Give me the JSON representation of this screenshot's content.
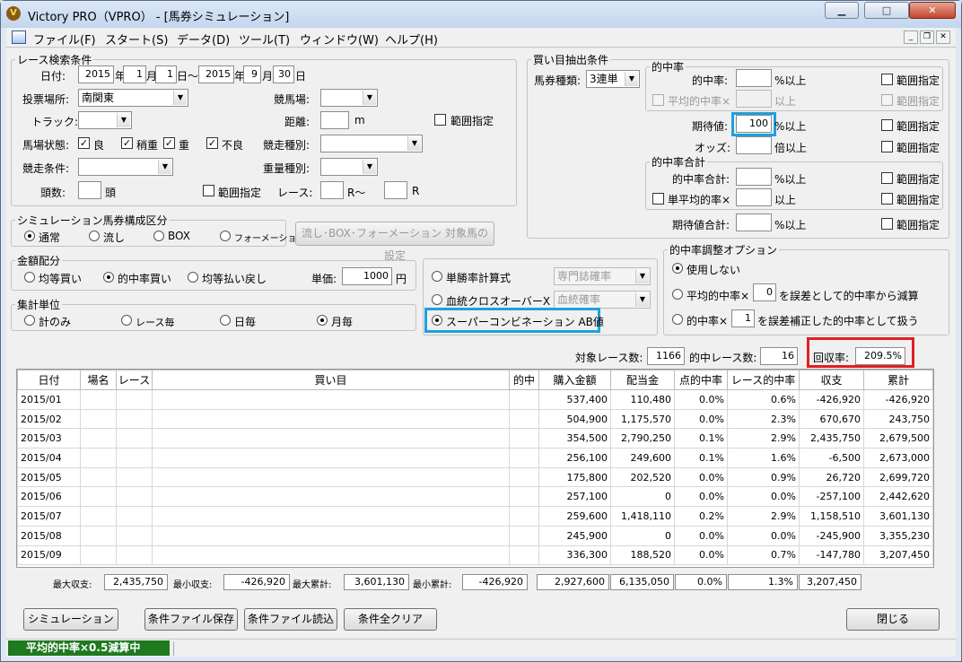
{
  "title": "Victory PRO（VPRO） - [馬券シミュレーション]",
  "menu": [
    "ファイル(F)",
    "スタート(S)",
    "データ(D)",
    "ツール(T)",
    "ウィンドウ(W)",
    "ヘルプ(H)"
  ],
  "race_search": {
    "legend": "レース検索条件",
    "date_label": "日付:",
    "y1": "2015",
    "y_unit": "年",
    "m1": "1",
    "m_unit": "月",
    "d1": "1",
    "d_unit_range": "日～",
    "y2": "2015",
    "m2": "9",
    "d2": "30",
    "d_unit": "日",
    "venue_label": "投票場所:",
    "venue": "南関東",
    "track_label": "競馬場:",
    "track": "",
    "course_label": "トラック:",
    "course": "",
    "distance_label": "距離:",
    "distance": "",
    "distance_unit": "m",
    "range_label": "範囲指定",
    "condition_label": "馬場状態:",
    "cond": [
      "良",
      "稍重",
      "重",
      "不良"
    ],
    "race_type_label": "競走種別:",
    "race_cond_label": "競走条件:",
    "weight_label": "重量種別:",
    "heads_label": "頭数:",
    "heads_unit": "頭",
    "race_label": "レース:",
    "race_r1": "R～",
    "race_r2": "R"
  },
  "sim_type": {
    "legend": "シミュレーション馬券構成区分",
    "options": [
      "通常",
      "流し",
      "BOX",
      "フォーメーション"
    ],
    "set_button": "流し･BOX･フォーメーション 対象馬の設定"
  },
  "money": {
    "legend": "金額配分",
    "options": [
      "均等買い",
      "的中率買い",
      "均等払い戻し"
    ],
    "unit_label": "単価:",
    "unit_value": "1000",
    "yen": "円"
  },
  "agg": {
    "legend": "集計単位",
    "options": [
      "計のみ",
      "レース毎",
      "日毎",
      "月毎"
    ]
  },
  "calc": {
    "options": [
      "単勝率計算式",
      "血統クロスオーバーX",
      "スーパーコンビネーション AB値"
    ],
    "combo1": "専門誌確率",
    "combo2": "血統確率"
  },
  "extract": {
    "legend": "買い目抽出条件",
    "bet_type_label": "馬券種類:",
    "bet_type": "3連単",
    "hit_legend": "的中率",
    "hit_rate": "的中率:",
    "pct_over": "%以上",
    "avg_hit": "平均的中率×",
    "over": "以上",
    "expect": "期待値:",
    "expect_value": "100",
    "odds": "オッズ:",
    "times_over": "倍以上",
    "range": "範囲指定",
    "total_legend": "的中率合計",
    "hit_total": "的中率合計:",
    "single_avg": "単平均的率×",
    "expect_total": "期待値合計:"
  },
  "adjust": {
    "legend": "的中率調整オプション",
    "opt1": "使用しない",
    "opt2a": "平均的中率×",
    "opt2v": "0",
    "opt2b": "を誤差として的中率から減算",
    "opt3a": "的中率×",
    "opt3v": "1",
    "opt3b": "を誤差補正した的中率として扱う"
  },
  "counts": {
    "target_label": "対象レース数:",
    "target": "1166",
    "hit_label": "的中レース数:",
    "hit": "16",
    "recovery_label": "回収率:",
    "recovery": "209.5%"
  },
  "table": {
    "headers": [
      "日付",
      "場名",
      "レース",
      "買い目",
      "的中",
      "購入金額",
      "配当金",
      "点的中率",
      "レース的中率",
      "収支",
      "累計"
    ],
    "rows": [
      [
        "2015/01",
        "",
        "",
        "",
        "",
        "537,400",
        "110,480",
        "0.0%",
        "0.6%",
        "-426,920",
        "-426,920"
      ],
      [
        "2015/02",
        "",
        "",
        "",
        "",
        "504,900",
        "1,175,570",
        "0.0%",
        "2.3%",
        "670,670",
        "243,750"
      ],
      [
        "2015/03",
        "",
        "",
        "",
        "",
        "354,500",
        "2,790,250",
        "0.1%",
        "2.9%",
        "2,435,750",
        "2,679,500"
      ],
      [
        "2015/04",
        "",
        "",
        "",
        "",
        "256,100",
        "249,600",
        "0.1%",
        "1.6%",
        "-6,500",
        "2,673,000"
      ],
      [
        "2015/05",
        "",
        "",
        "",
        "",
        "175,800",
        "202,520",
        "0.0%",
        "0.9%",
        "26,720",
        "2,699,720"
      ],
      [
        "2015/06",
        "",
        "",
        "",
        "",
        "257,100",
        "0",
        "0.0%",
        "0.0%",
        "-257,100",
        "2,442,620"
      ],
      [
        "2015/07",
        "",
        "",
        "",
        "",
        "259,600",
        "1,418,110",
        "0.2%",
        "2.9%",
        "1,158,510",
        "3,601,130"
      ],
      [
        "2015/08",
        "",
        "",
        "",
        "",
        "245,900",
        "0",
        "0.0%",
        "0.0%",
        "-245,900",
        "3,355,230"
      ],
      [
        "2015/09",
        "",
        "",
        "",
        "",
        "336,300",
        "188,520",
        "0.0%",
        "0.7%",
        "-147,780",
        "3,207,450"
      ]
    ]
  },
  "summary": {
    "max_income_label": "最大収支:",
    "max_income": "2,435,750",
    "min_income_label": "最小収支:",
    "min_income": "-426,920",
    "max_total_label": "最大累計:",
    "max_total": "3,601,130",
    "min_total_label": "最小累計:",
    "min_total": "-426,920",
    "purchase": "2,927,600",
    "payout": "6,135,050",
    "point_rate": "0.0%",
    "race_rate": "1.3%",
    "balance": "3,207,450"
  },
  "buttons": {
    "simulate": "シミュレーション",
    "save": "条件ファイル保存",
    "load": "条件ファイル読込",
    "clear": "条件全クリア",
    "close": "閉じる"
  },
  "status": "平均的中率×0.5減算中"
}
